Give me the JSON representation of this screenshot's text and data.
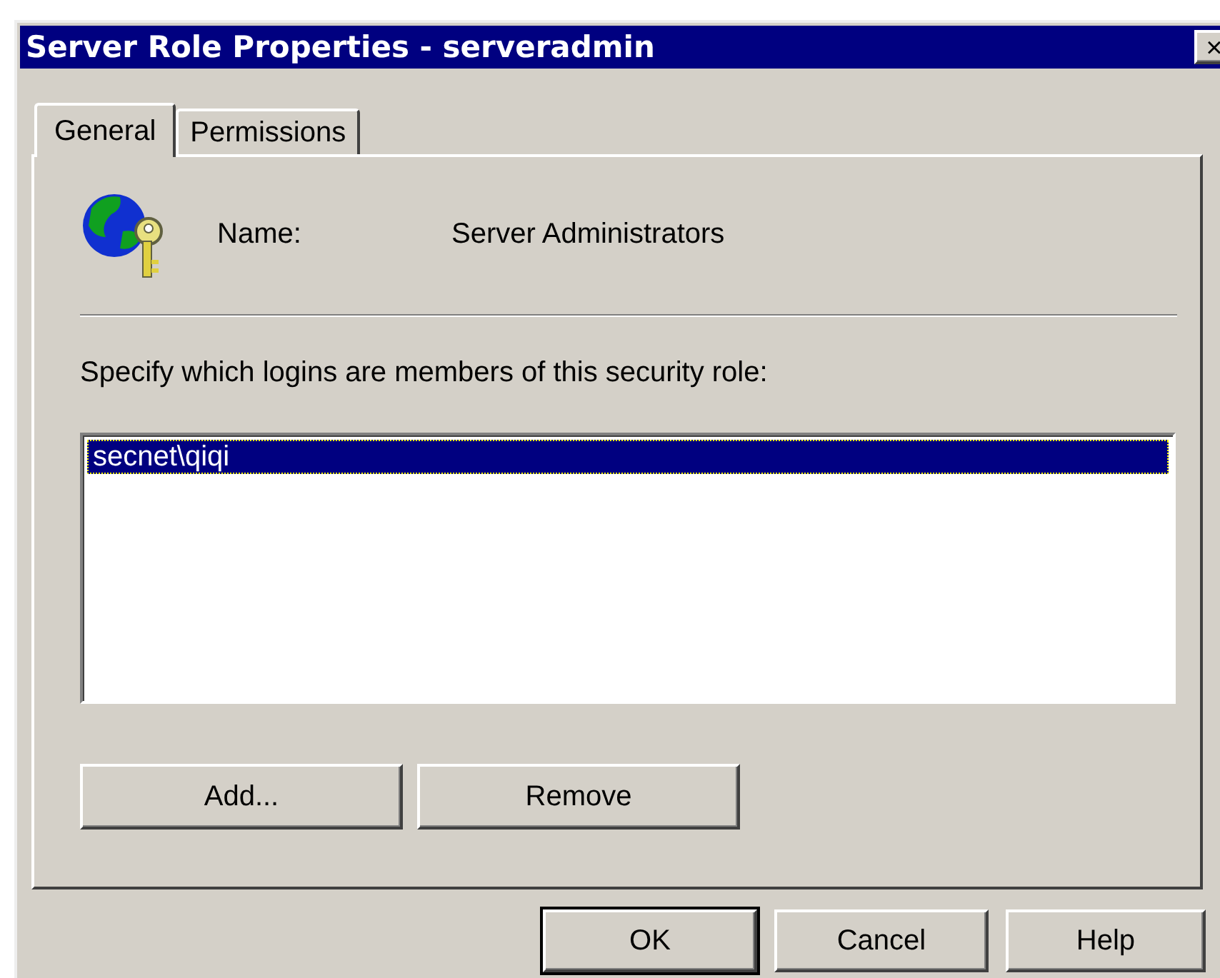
{
  "window": {
    "title": "Server Role Properties - serveradmin",
    "close": "×"
  },
  "tabs": [
    {
      "label": "General",
      "selected": true
    },
    {
      "label": "Permissions",
      "selected": false
    }
  ],
  "name": {
    "label": "Name:",
    "value": "Server Administrators"
  },
  "members": {
    "label": "Specify which logins are members of this security role:",
    "items": [
      {
        "text": "secnet\\qiqi",
        "selected": true
      }
    ]
  },
  "member_buttons": [
    "Add...",
    "Remove"
  ],
  "buttons": [
    {
      "label": "OK",
      "default": true
    },
    {
      "label": "Cancel",
      "default": false
    },
    {
      "label": "Help",
      "default": false
    }
  ]
}
